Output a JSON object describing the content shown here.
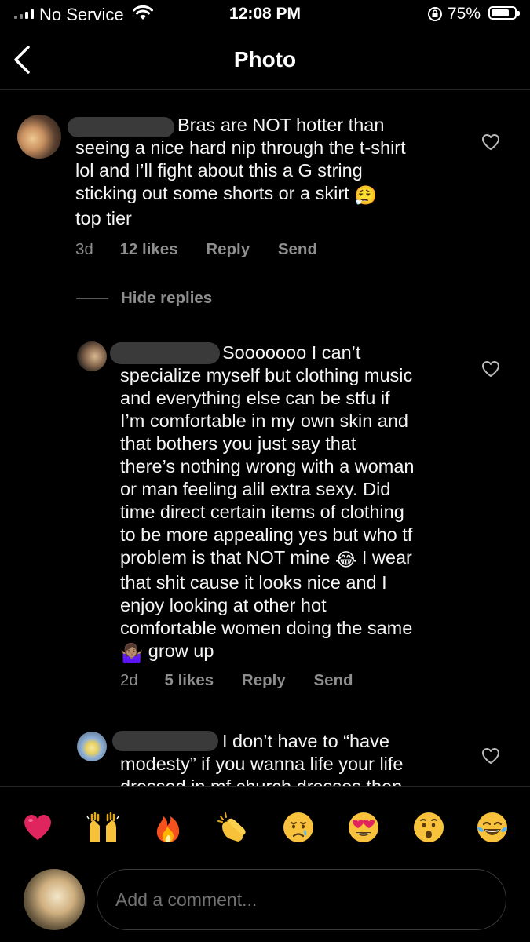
{
  "status_bar": {
    "carrier": "No Service",
    "time": "12:08 PM",
    "battery_percent": "75%",
    "battery_level": 0.75
  },
  "header": {
    "title": "Photo",
    "back_icon": "chevron-left-icon"
  },
  "comments": [
    {
      "text": "Bras are NOT hotter than\nseeing a nice hard nip through the t-shirt\nlol and I’ll fight about this a G string\nsticking out some shorts or a skirt ",
      "text_after_emoji": "\ntop tier",
      "emoji": "😮‍💨",
      "age": "3d",
      "likes": "12 likes",
      "reply": "Reply",
      "send": "Send"
    }
  ],
  "hide_replies_label": "Hide replies",
  "replies": [
    {
      "text_part1": "Sooooooo I can’t\nspecialize myself but clothing music\nand everything else can be stfu if\nI’m comfortable in my own skin and\nthat bothers you just say that\nthere’s nothing wrong with a woman\nor man feeling alil extra sexy. Did\ntime direct certain items of clothing\nto be more appealing yes but who tf\nproblem is that NOT mine ",
      "emoji1": "😂",
      "text_part2": " I wear\nthat shit cause it looks nice and I\nenjoy looking at other hot\ncomfortable women doing the same\n",
      "emoji2": "🤷🏽‍♀️",
      "text_part3": " grow up",
      "age": "2d",
      "likes": "5 likes",
      "reply": "Reply",
      "send": "Send"
    },
    {
      "text": "I don’t have to “have\nmodesty” if you wanna life your life\ndressed in mf church dresses then"
    }
  ],
  "reactions": [
    "❤️",
    "🙌",
    "🔥",
    "👏",
    "😢",
    "😍",
    "😮",
    "😂"
  ],
  "composer": {
    "placeholder": "Add a comment..."
  }
}
